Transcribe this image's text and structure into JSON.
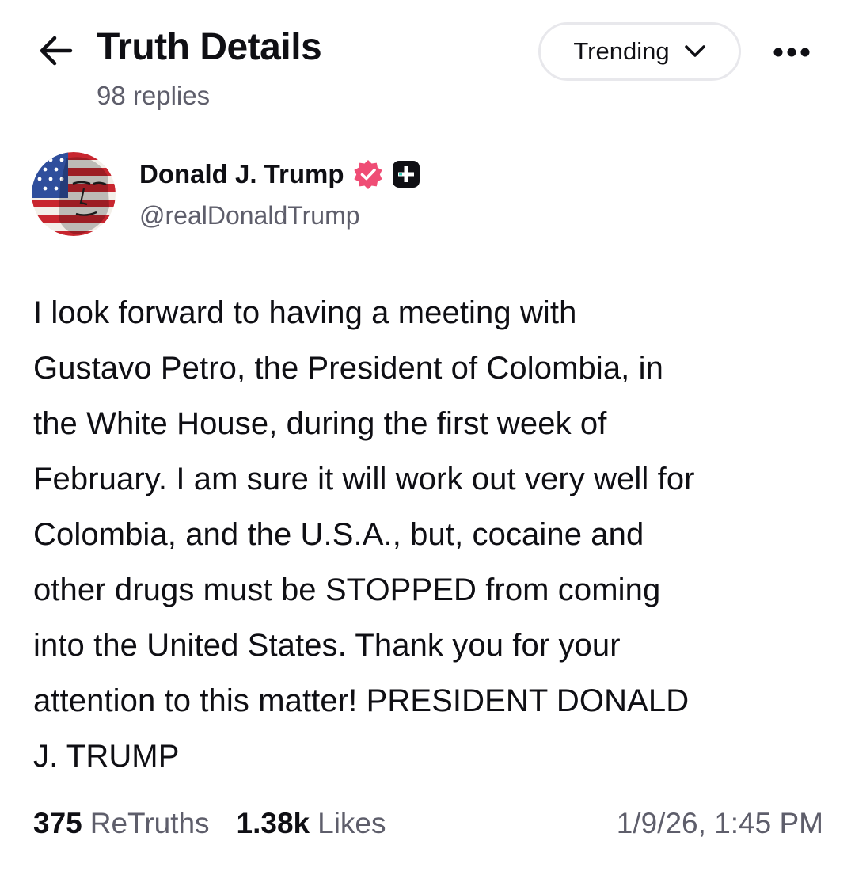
{
  "header": {
    "title": "Truth Details",
    "replies": "98 replies",
    "sort_label": "Trending",
    "back_icon": "arrow-left-icon",
    "more_icon": "ellipsis-icon"
  },
  "author": {
    "name": "Donald J. Trump",
    "handle": "@realDonaldTrump",
    "verified_color": "#ef4d75",
    "plus_badge_color": "#0f0f14"
  },
  "post": {
    "lines": [
      "I look forward to having a meeting with",
      "Gustavo Petro, the President of Colombia, in",
      "the White House, during the first week of",
      "February. I am sure it will work out very well for",
      "Colombia, and the U.S.A., but, cocaine and",
      "other drugs must be STOPPED from coming",
      "into the United States. Thank you for your",
      "attention to this matter! PRESIDENT DONALD",
      "J. TRUMP"
    ]
  },
  "stats": {
    "retruths_count": "375",
    "retruths_label": "ReTruths",
    "likes_count": "1.38k",
    "likes_label": "Likes",
    "timestamp": "1/9/26, 1:45 PM"
  }
}
